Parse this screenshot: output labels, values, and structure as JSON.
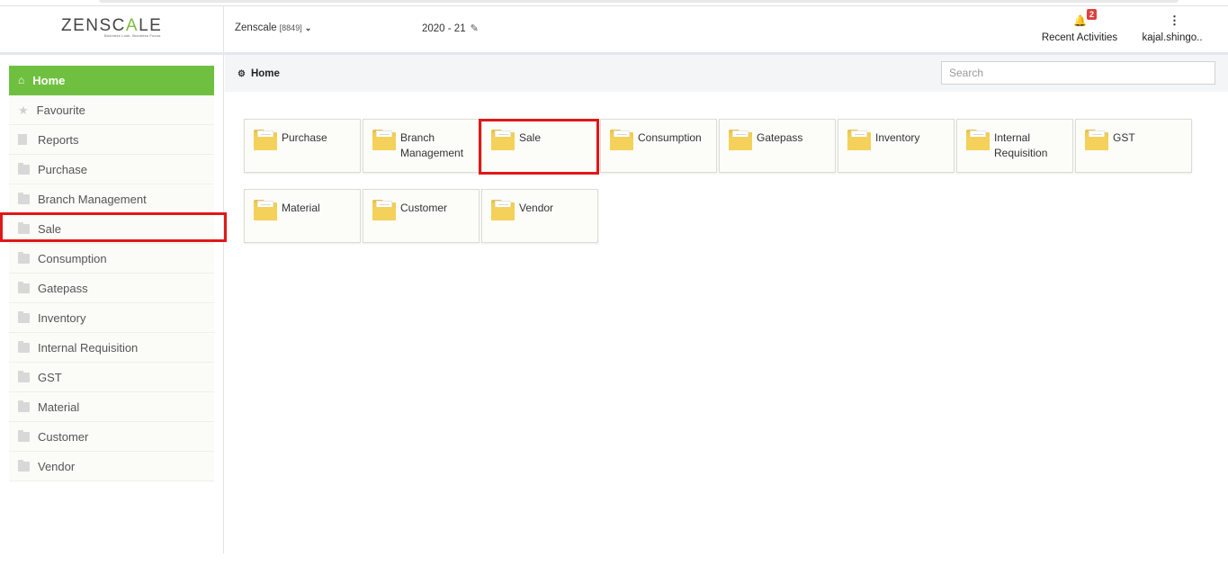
{
  "header": {
    "logo_prefix": "ZENSC",
    "logo_accent": "A",
    "logo_suffix": "LE",
    "tagline": "Business Look. Business Focus.",
    "company_name": "Zenscale",
    "company_code": "[8849]",
    "year": "2020 - 21",
    "recent_label": "Recent Activities",
    "notification_count": "2",
    "user_label": "kajal.shingo.."
  },
  "sidebar": {
    "items": [
      {
        "label": "Home",
        "icon": "home-icon"
      },
      {
        "label": "Favourite",
        "icon": "star-icon"
      },
      {
        "label": "Reports",
        "icon": "document-icon"
      },
      {
        "label": "Purchase",
        "icon": "folder-icon"
      },
      {
        "label": "Branch Management",
        "icon": "folder-icon"
      },
      {
        "label": "Sale",
        "icon": "folder-icon"
      },
      {
        "label": "Consumption",
        "icon": "folder-icon"
      },
      {
        "label": "Gatepass",
        "icon": "folder-icon"
      },
      {
        "label": "Inventory",
        "icon": "folder-icon"
      },
      {
        "label": "Internal Requisition",
        "icon": "folder-icon"
      },
      {
        "label": "GST",
        "icon": "folder-icon"
      },
      {
        "label": "Material",
        "icon": "folder-icon"
      },
      {
        "label": "Customer",
        "icon": "folder-icon"
      },
      {
        "label": "Vendor",
        "icon": "folder-icon"
      }
    ]
  },
  "breadcrumb": {
    "label": "Home"
  },
  "search": {
    "placeholder": "Search"
  },
  "tiles": [
    {
      "label": "Purchase"
    },
    {
      "label": "Branch Management"
    },
    {
      "label": "Sale"
    },
    {
      "label": "Consumption"
    },
    {
      "label": "Gatepass"
    },
    {
      "label": "Inventory"
    },
    {
      "label": "Internal Requisition"
    },
    {
      "label": "GST"
    },
    {
      "label": "Material"
    },
    {
      "label": "Customer"
    },
    {
      "label": "Vendor"
    }
  ],
  "colors": {
    "accent": "#6fc040",
    "highlight": "#e01818",
    "folder": "#f1cd55"
  }
}
